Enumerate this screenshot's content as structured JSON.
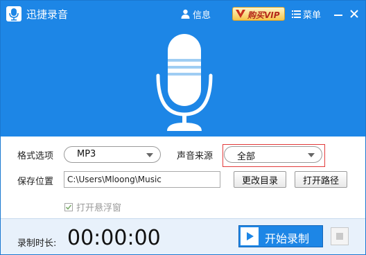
{
  "app": {
    "title": "迅捷录音",
    "accent_color": "#1d86e6"
  },
  "titlebar": {
    "info_label": "信息",
    "info_icon": "user-icon",
    "vip_label": "购买VIP",
    "menu_label": "菜单",
    "menu_icon": "hamburger-icon",
    "minimize_icon": "minimize-icon",
    "close_icon": "close-icon"
  },
  "hero": {
    "icon": "microphone-icon"
  },
  "settings": {
    "format_label": "格式选项",
    "format_value": "MP3",
    "source_label": "声音来源",
    "source_value": "全部",
    "save_label": "保存位置",
    "save_path": "C:\\Users\\Mloong\\Music",
    "change_dir_button": "更改目录",
    "open_path_button": "打开路径",
    "float_window_label": "打开悬浮窗",
    "float_window_checked": true,
    "highlight_color": "#e23a3a"
  },
  "bottom": {
    "duration_label": "录制时长:",
    "timer": "00:00:00",
    "start_button": "开始录制",
    "play_icon": "play-icon",
    "stop_icon": "stop-icon"
  }
}
